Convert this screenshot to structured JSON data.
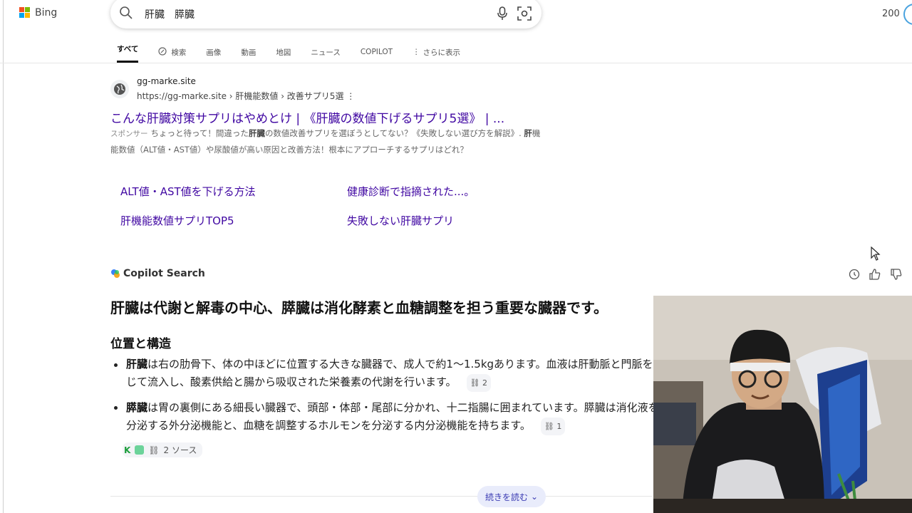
{
  "header": {
    "logo_text": "Bing",
    "search_query": "肝臓　膵臓",
    "rewards_count": "200"
  },
  "tabs": [
    {
      "label": "すべて"
    },
    {
      "label": "検索"
    },
    {
      "label": "画像"
    },
    {
      "label": "動画"
    },
    {
      "label": "地図"
    },
    {
      "label": "ニュース"
    },
    {
      "label": "COPILOT"
    },
    {
      "label": "さらに表示"
    }
  ],
  "ad": {
    "site_name": "gg-marke.site",
    "url": "https://gg-marke.site › 肝機能数値 › 改善サプリ5選",
    "title": "こんな肝臓対策サプリはやめとけ | 《肝臓の数値下げるサプリ5選》 | ...",
    "sponsor_label": "スポンサー",
    "desc_part1": "ちょっと待って！間違った",
    "desc_bold1": "肝臓",
    "desc_part2": "の数値改善サプリを選ぼうとしてない？《失敗しない選び方を解説》.",
    "desc_bold2": "肝",
    "desc_part3": "機能数値（ALT値・AST値）や尿酸値が高い原因と改善方法！根本にアプローチするサプリはどれ？",
    "sitelinks": [
      "ALT値・AST値を下げる方法",
      "健康診断で指摘された...。",
      "肝機能数値サプリTOP5",
      "失敗しない肝臓サプリ"
    ]
  },
  "copilot": {
    "header": "Copilot Search",
    "title": "肝臓は代謝と解毒の中心、膵臓は消化酵素と血糖調整を担う重要な臓器です。",
    "section": "位置と構造",
    "bullets": [
      {
        "bold": "肝臓",
        "text": "は右の肋骨下、体の中ほどに位置する大きな臓器で、成人で約1〜1.5kgあります。血液は肝動脈と門脈を通じて流入し、酸素供給と腸から吸収された栄養素の代謝を行います。",
        "cite": "2"
      },
      {
        "bold": "膵臓",
        "text": "は胃の裏側にある細長い臓器で、頭部・体部・尾部に分かれ、十二指腸に囲まれています。膵臓は消化液を分泌する外分泌機能と、血糖を調整するホルモンを分泌する内分泌機能を持ちます。",
        "cite": "1"
      }
    ],
    "sources_label": "2 ソース",
    "read_more": "続きを読む"
  },
  "colors": {
    "link": "#4007a2",
    "accent": "#3b3bb3"
  }
}
